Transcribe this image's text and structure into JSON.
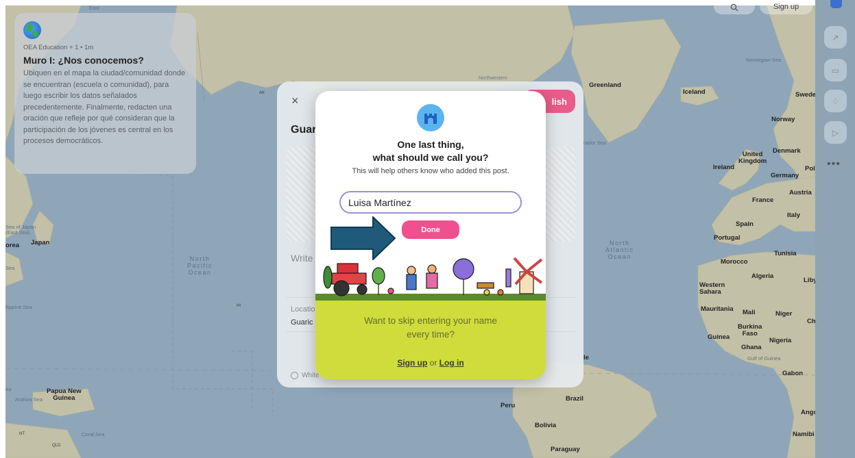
{
  "map": {
    "labels": {
      "east_top": "East",
      "greenland": "Greenland",
      "iceland": "Iceland",
      "norwegian_sea": "Norwegian Sea",
      "sweden": "Swede",
      "norway": "Norway",
      "denmark": "Denmark",
      "united_kingdom": "United\nKingdom",
      "ireland": "Ireland",
      "germany": "Germany",
      "poland": "Pol",
      "austria": "Austria",
      "france": "France",
      "italy": "Italy",
      "spain": "Spain",
      "portugal": "Portugal",
      "tunisia": "Tunisia",
      "morocco": "Morocco",
      "algeria": "Algeria",
      "libya": "Liby",
      "western_sahara": "Western\nSahara",
      "mauritania": "Mauritania",
      "mali": "Mali",
      "niger": "Niger",
      "chad": "Ch",
      "burkina_faso": "Burkina\nFaso",
      "guinea": "Guinea",
      "nigeria": "Nigeria",
      "ghana": "Ghana",
      "gulf_of_guinea": "Gulf of Guinea",
      "gabon": "Gabon",
      "angola": "Ango",
      "namibia": "Namibi",
      "north_atlantic": "North\nAtlantic\nOcean",
      "north_pacific": "North\nPacific\nOcean",
      "sea_of_japan": "Sea of Japan\n(East Sea)",
      "korea": "orea",
      "japan": "Japan",
      "philippine_sea": "ilippine Sea",
      "papua_new_guinea": "Papua New\nGuinea",
      "arafura_sea": "Arafura Sea",
      "coral_sea": "Coral Sea",
      "nt": "NT",
      "qld": "QLD",
      "hi": "HI",
      "ak": "AK",
      "northwestern": "Northwestern",
      "labrador_sea": "rador Sea",
      "brazil": "Brazil",
      "peru": "Peru",
      "bolivia": "Bolivia",
      "paraguay": "Paraguay",
      "sea_left": "Sea",
      "sea_left2": "ea",
      "le": "le"
    }
  },
  "topbar": {
    "search_icon": "search-icon",
    "signup_label": "Sign up"
  },
  "rail": {
    "more_label": "•••"
  },
  "wall_card": {
    "meta": "OEA Education + 1 • 1m",
    "title": "Muro I: ¿Nos conocemos?",
    "description": "Ubiquen en el mapa la ciudad/comunidad donde se encuentran (escuela o comunidad), para luego escribir los datos señalados precedentemente. Finalmente, redacten una oración que refleje por qué consideran que la participación de los jóvenes es central en los procesos democráticos."
  },
  "composer": {
    "close_label": "×",
    "publish_label": "lish",
    "title_partial": "Guar",
    "write_placeholder": "Write",
    "location_label": "Locatio",
    "location_value": "Guaric",
    "white_option": "White"
  },
  "name_modal": {
    "title_line1": "One last thing,",
    "title_line2": "what should we call you?",
    "subtitle": "This will help others know who added this post.",
    "name_value": "Luisa Martínez",
    "done_label": "Done",
    "skip_text_line1": "Want to skip entering your name",
    "skip_text_line2": "every time?",
    "signup_link": "Sign up",
    "or_text": " or ",
    "login_link": "Log in"
  },
  "colors": {
    "accent_pink": "#f0508d",
    "input_border": "#9b8fd6",
    "skip_green": "#cfdc3c",
    "logo_blue": "#5ab4ee",
    "arrow_fill": "#1f5a7a"
  }
}
